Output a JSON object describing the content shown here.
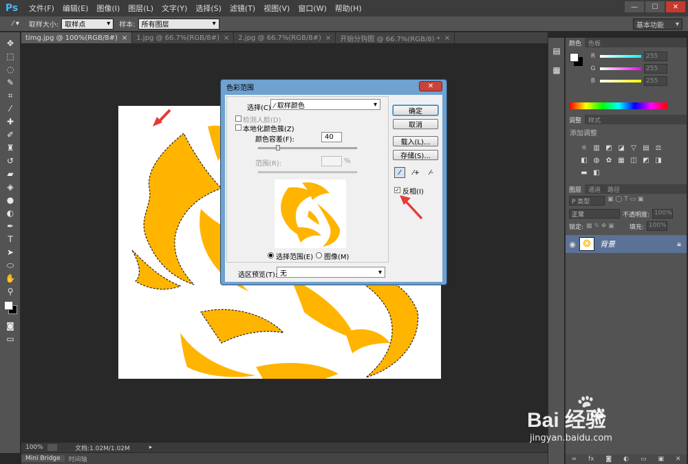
{
  "app": {
    "logo": "Ps"
  },
  "menu": [
    "文件(F)",
    "编辑(E)",
    "图像(I)",
    "图层(L)",
    "文字(Y)",
    "选择(S)",
    "滤镜(T)",
    "视图(V)",
    "窗口(W)",
    "帮助(H)"
  ],
  "window_controls": {
    "minimize": "—",
    "maximize": "☐",
    "close": "✕"
  },
  "options": {
    "sample_size_label": "取样大小:",
    "sample_size_value": "取样点",
    "sample_label": "样本:",
    "sample_value": "所有图层",
    "workspace": "基本功能"
  },
  "tabs": [
    {
      "label": "timg.jpg @ 100%(RGB/8#)",
      "close": "×"
    },
    {
      "label": "1.jpg @ 66.7%(RGB/8#)",
      "close": "×"
    },
    {
      "label": "2.jpg @ 66.7%(RGB/8#)",
      "close": "×"
    },
    {
      "label": "开始分钩图 @ 66.7%(RGB/8) *",
      "close": "×"
    }
  ],
  "status": {
    "zoom": "100%",
    "doc": "文档:1.02M/1.02M"
  },
  "bottom_tabs": [
    "Mini Bridge",
    "时间轴"
  ],
  "color_panel": {
    "tabs": [
      "颜色",
      "色板"
    ],
    "r_label": "R",
    "g_label": "G",
    "b_label": "B",
    "r": "255",
    "g": "255",
    "b": "255",
    "colors": {
      "r": "#00ffff",
      "g": "#ff00ff",
      "b": "#ffff00"
    }
  },
  "adjust_panel": {
    "tabs": [
      "调整",
      "样式"
    ],
    "hint": "添加调整"
  },
  "layers_panel": {
    "tabs": [
      "图层",
      "通道",
      "路径"
    ],
    "kind": "P 类型",
    "blend": "正常",
    "opacity_label": "不透明度:",
    "opacity": "100%",
    "lock_label": "锁定:",
    "fill_label": "填充:",
    "fill": "100%",
    "layer_name": "背景"
  },
  "dialog": {
    "title": "色彩范围",
    "close": "✕",
    "select_label": "选择(C):",
    "select_value": "取样颜色",
    "detect_faces": "检测人脸(D)",
    "localized": "本地化颜色簇(Z)",
    "fuzziness_label": "颜色容差(F):",
    "fuzziness": "40",
    "range_label": "范围(R):",
    "range_unit": "%",
    "preview_selection": "选择范围(E)",
    "preview_image": "图像(M)",
    "selection_preview_label": "选区预览(T):",
    "selection_preview_value": "无",
    "ok": "确定",
    "cancel": "取消",
    "load": "载入(L)...",
    "save": "存储(S)...",
    "invert": "反相(I)",
    "invert_checked": "✓"
  },
  "watermark": {
    "brand": "Bai 经验",
    "url": "jingyan.baidu.com"
  },
  "colors": {
    "dragon": "#ffb400",
    "arrow": "#e53b36",
    "dialog_frame": "#6fa1d1"
  }
}
